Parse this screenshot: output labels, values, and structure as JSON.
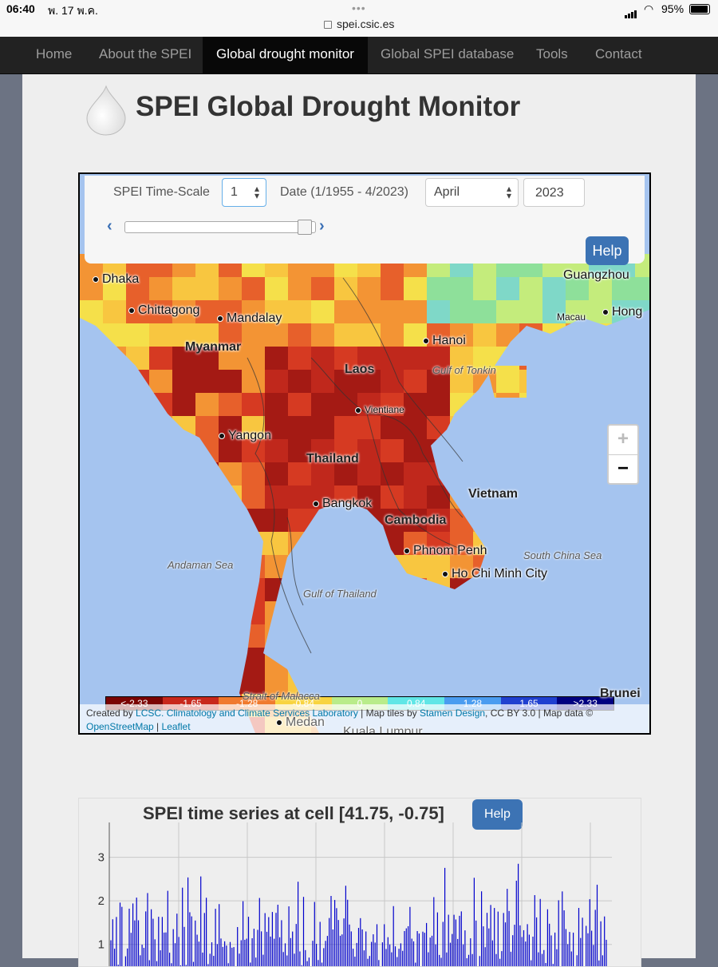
{
  "status_bar": {
    "time": "06:40",
    "date": "พ. 17 พ.ค.",
    "url": "spei.csic.es",
    "battery": "95%"
  },
  "nav": {
    "items": [
      "Home",
      "About the SPEI",
      "Global drought monitor",
      "Global SPEI database",
      "Tools",
      "Contact"
    ],
    "active": "Global drought monitor"
  },
  "page_title": "SPEI Global Drought Monitor",
  "controls": {
    "timescale_label": "SPEI Time-Scale",
    "timescale_value": "1",
    "date_label": "Date (1/1955 - 4/2023)",
    "month_value": "April",
    "year_value": "2023",
    "help_label": "Help",
    "slider_position": 0.94
  },
  "map": {
    "cities": [
      "Dhaka",
      "Chittagong",
      "Mandalay",
      "Hanoi",
      "Guangzhou",
      "Macau",
      "Hong",
      "Vientiane",
      "Yangon",
      "Bangkok",
      "Phnom Penh",
      "Ho Chi Minh City",
      "Medan",
      "Kuala Lumpur"
    ],
    "countries": [
      "Myanmar",
      "Laos",
      "Thailand",
      "Cambodia",
      "Vietnam",
      "Brunei"
    ],
    "seas": [
      "Gulf of Tonkin",
      "Andaman Sea",
      "Gulf of Thailand",
      "South China Sea",
      "Strait of Malacca"
    ],
    "zoom_in": "+",
    "zoom_out": "−",
    "legend": [
      "<-2.33",
      "-1.65",
      "-1.28",
      "-0.84",
      "0",
      "0.84",
      "1.28",
      "1.65",
      ">2.33"
    ],
    "legend_colors": [
      "#7a0403",
      "#c8281c",
      "#f07a2d",
      "#f8d440",
      "#b9ec8a",
      "#60e6e6",
      "#4a9cf0",
      "#2040d0",
      "#000080"
    ],
    "attribution_pre": "Created by ",
    "attribution_mid": "LCSC. Climatology and Climate Services Laboratory",
    "attribution_post": " | Map tiles by ",
    "attribution_stamen": "Stamen Design",
    "attribution_end": ", CC BY 3.0 | Map data ©",
    "attribution_osm": "OpenStreetMap",
    "attribution_sep": " | ",
    "attribution_leaflet": "Leaflet"
  },
  "chart": {
    "title": "SPEI time series at cell [41.75, -0.75]",
    "help_label": "Help"
  },
  "chart_data": {
    "type": "bar",
    "title": "SPEI time series at cell [41.75, -0.75]",
    "y_ticks": [
      "1",
      "2",
      "3"
    ],
    "ylim_visible": [
      0.5,
      3.8
    ],
    "series_color": "#0000cc",
    "values_sample": [
      1.2,
      0.7,
      1.4,
      2.0,
      0.9,
      1.6,
      1.1,
      2.3,
      0.8,
      1.5,
      1.9,
      0.6,
      1.3,
      2.5,
      1.0,
      1.7,
      0.9,
      1.4,
      2.1,
      1.2,
      0.8,
      1.6,
      1.8,
      1.0,
      2.4,
      1.3,
      0.7,
      1.5,
      1.9,
      1.1
    ]
  }
}
